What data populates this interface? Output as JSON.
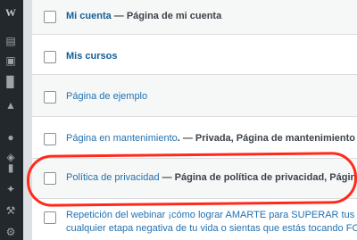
{
  "sidebar": {
    "icons": [
      "wordpress-logo-icon",
      "posts-icon",
      "media-icon",
      "stats-icon",
      "megaphone-icon",
      "comments-icon",
      "appearance-icon",
      "folder-icon",
      "pin-icon",
      "tools-icon",
      "settings-icon",
      "collapse-icon"
    ]
  },
  "pages": [
    {
      "title": "Mi cuenta",
      "suffix": " — Página de mi cuenta"
    },
    {
      "title": "Mis cursos",
      "suffix": ""
    },
    {
      "title": "Página de ejemplo",
      "suffix": ""
    },
    {
      "title": "Página en mantenimiento",
      "suffix": ". — Privada, Página de mantenimiento"
    },
    {
      "title": "Política de privacidad",
      "suffix": " — Página de política de privacidad, Página de s"
    },
    {
      "title": "Repetición del webinar ¡cómo lograr AMARTE para SUPERAR tus DESA",
      "line2": "cualquier etapa negativa de tu vida o sientas que estás tocando FOND"
    }
  ],
  "colors": {
    "highlight": "#ff2a1a",
    "link": "#135e96",
    "sidebar": "#23282d"
  }
}
